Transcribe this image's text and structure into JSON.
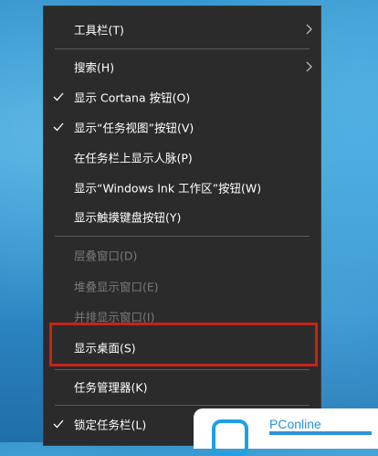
{
  "menu": {
    "items": [
      {
        "label": "工具栏(T)",
        "submenu": true,
        "checked": false,
        "disabled": false
      },
      {
        "label": "搜索(H)",
        "submenu": true,
        "checked": false,
        "disabled": false
      },
      {
        "label": "显示 Cortana 按钮(O)",
        "submenu": false,
        "checked": true,
        "disabled": false
      },
      {
        "label": "显示“任务视图”按钮(V)",
        "submenu": false,
        "checked": true,
        "disabled": false
      },
      {
        "label": "在任务栏上显示人脉(P)",
        "submenu": false,
        "checked": false,
        "disabled": false
      },
      {
        "label": "显示“Windows Ink 工作区”按钮(W)",
        "submenu": false,
        "checked": false,
        "disabled": false
      },
      {
        "label": "显示触摸键盘按钮(Y)",
        "submenu": false,
        "checked": false,
        "disabled": false
      },
      {
        "label": "层叠窗口(D)",
        "submenu": false,
        "checked": false,
        "disabled": true
      },
      {
        "label": "堆叠显示窗口(E)",
        "submenu": false,
        "checked": false,
        "disabled": true
      },
      {
        "label": "并排显示窗口(I)",
        "submenu": false,
        "checked": false,
        "disabled": true
      },
      {
        "label": "显示桌面(S)",
        "submenu": false,
        "checked": false,
        "disabled": false
      },
      {
        "label": "任务管理器(K)",
        "submenu": false,
        "checked": false,
        "disabled": false
      },
      {
        "label": "锁定任务栏(L)",
        "submenu": false,
        "checked": true,
        "disabled": false
      }
    ]
  },
  "watermark": {
    "brand": "PConline"
  },
  "colors": {
    "menu_bg": "#2b2b2b",
    "highlight": "#c8231b",
    "brand": "#2a92d8"
  }
}
